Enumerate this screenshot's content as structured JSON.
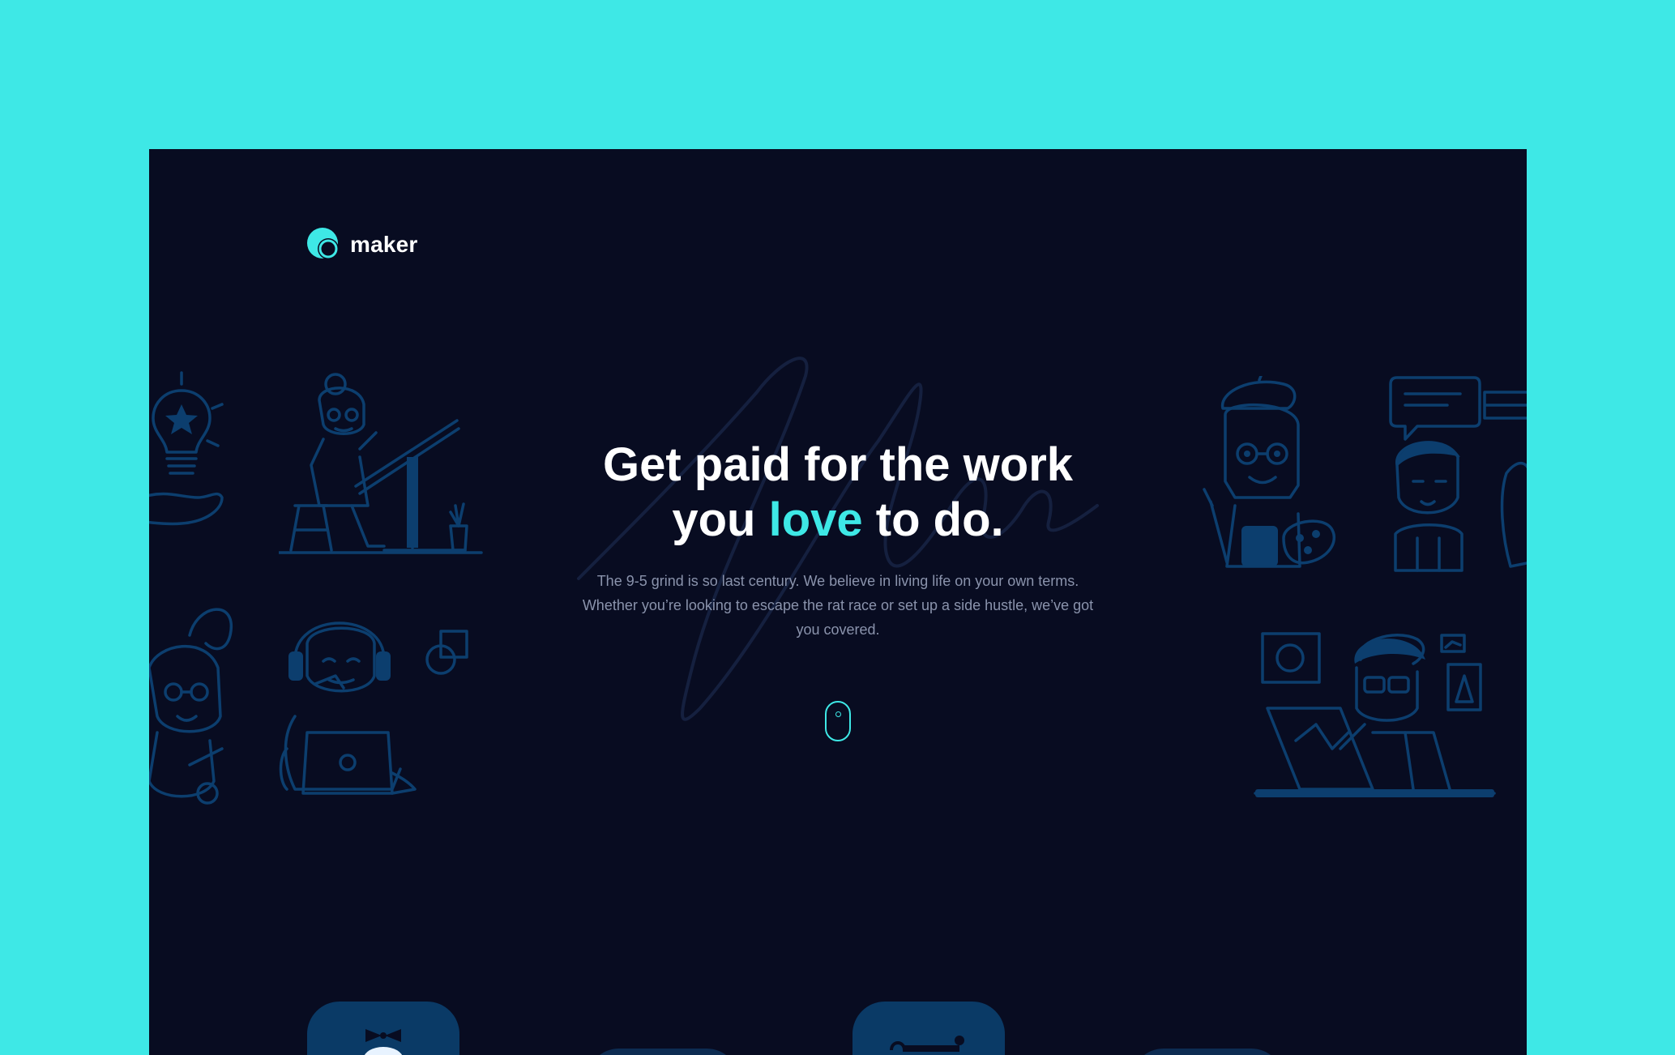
{
  "brand": {
    "name": "maker",
    "accent_color": "#3ee8e6",
    "background_color": "#080c21",
    "page_color": "#3ee8e6"
  },
  "hero": {
    "title_line1": "Get paid for the work",
    "title_line2_before": "you ",
    "title_line2_accent": "love",
    "title_line2_after": " to do.",
    "description": "The 9-5 grind is so last century. We believe in living life on your own terms. Whether you’re looking to escape the rat race or set up a side hustle, we’ve got you covered."
  },
  "scroll": {
    "icon": "mouse-scroll-icon"
  },
  "illustrations": [
    "lightbulb-hand-icon",
    "drafting-woman-illustration",
    "bunny-costume-child-illustration",
    "headphones-laptop-woman-illustration",
    "painter-woman-illustration",
    "chat-bubble-man-illustration",
    "tablet-designer-man-illustration"
  ]
}
